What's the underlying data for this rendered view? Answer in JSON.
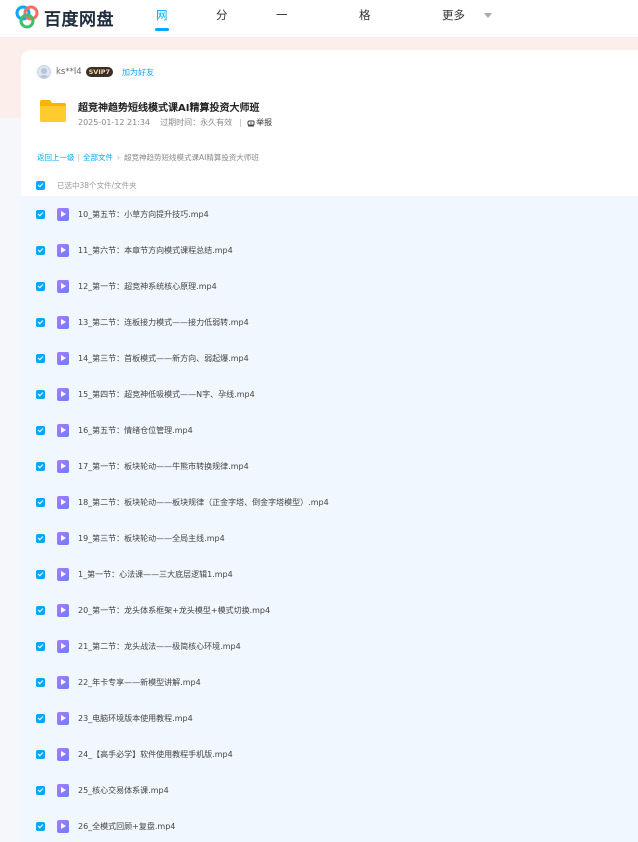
{
  "header": {
    "logo_text": "百度网盘",
    "nav": [
      {
        "label": "网盘"
      },
      {
        "label": "分享"
      },
      {
        "label": "一刻相册"
      },
      {
        "label": "格式转换"
      },
      {
        "label": "更多"
      }
    ],
    "accent_color": "#06a7ff"
  },
  "share": {
    "username": "ks**l4",
    "vip_badge": "SVIP7",
    "add_friend": "加为好友",
    "title": "超竞神趋势短线模式课AI精算投资大师班",
    "date": "2025-01-12 21:34",
    "expiry": "过期时间：永久有效",
    "report": "举报"
  },
  "breadcrumb": {
    "back": "返回上一级",
    "all_files": "全部文件",
    "current": "超竞神趋势短线模式课AI精算投资大师班"
  },
  "selection_text": "已选中38个文件/文件夹",
  "files": [
    {
      "name": "10_第五节：小草方向提升技巧.mp4"
    },
    {
      "name": "11_第六节：本章节方向模式课程总结.mp4"
    },
    {
      "name": "12_第一节：超竞神系统核心原理.mp4"
    },
    {
      "name": "13_第二节：连板接力模式——接力低弱转.mp4"
    },
    {
      "name": "14_第三节：首板模式——新方向、弱起爆.mp4"
    },
    {
      "name": "15_第四节：超竞神低吸模式——N字、孕线.mp4"
    },
    {
      "name": "16_第五节：情绪仓位管理.mp4"
    },
    {
      "name": "17_第一节：板块轮动——牛熊市转换规律.mp4"
    },
    {
      "name": "18_第二节：板块轮动——板块规律（正金字塔、倒金字塔模型）.mp4"
    },
    {
      "name": "19_第三节：板块轮动——全局主线.mp4"
    },
    {
      "name": "1_第一节：心法课——三大底层逻辑1.mp4"
    },
    {
      "name": "20_第一节：龙头体系框架+龙头模型+模式切换.mp4"
    },
    {
      "name": "21_第二节：龙头战法——极简核心环境.mp4"
    },
    {
      "name": "22_年卡专享——新模型讲解.mp4"
    },
    {
      "name": "23_电脑环境版本使用教程.mp4"
    },
    {
      "name": "24_【高手必学】软件使用教程手机版.mp4"
    },
    {
      "name": "25_核心交易体系课.mp4"
    },
    {
      "name": "26_全模式回顾+复盘.mp4"
    }
  ]
}
